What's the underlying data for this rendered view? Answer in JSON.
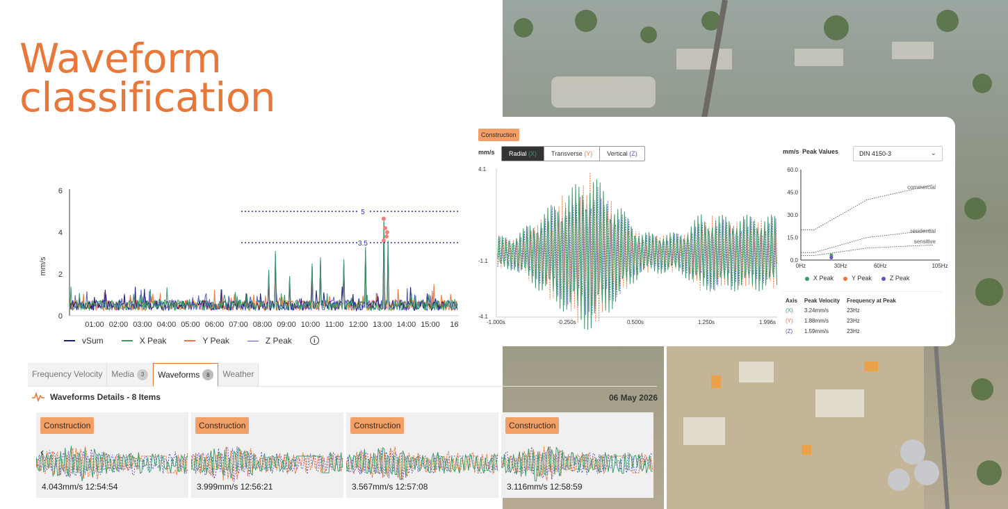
{
  "title": {
    "line1": "Waveform",
    "line2": "classification"
  },
  "main_chart": {
    "ylabel": "mm/s",
    "yticks": [
      "0",
      "2",
      "4",
      "6"
    ],
    "xticks": [
      "01:00",
      "02:00",
      "03:00",
      "04:00",
      "05:00",
      "06:00",
      "07:00",
      "08:00",
      "09:00",
      "10:00",
      "11:00",
      "12:00",
      "13:00",
      "14:00",
      "15:00",
      "16"
    ],
    "threshold_labels": [
      "5",
      "3.5"
    ],
    "legend": [
      {
        "name": "vSum",
        "color": "#1b1e7a"
      },
      {
        "name": "X Peak",
        "color": "#3a9a6a"
      },
      {
        "name": "Y Peak",
        "color": "#e8773a"
      },
      {
        "name": "Z Peak",
        "color": "#5b58c8"
      }
    ]
  },
  "chart_data": [
    {
      "type": "line",
      "ylabel": "mm/s",
      "ylim": [
        0,
        6
      ],
      "thresholds": [
        5,
        3.5
      ],
      "series": [
        {
          "name": "vSum"
        },
        {
          "name": "X Peak"
        },
        {
          "name": "Y Peak"
        },
        {
          "name": "Z Peak"
        }
      ],
      "max_value": 4.7,
      "max_time": "12:54"
    },
    {
      "type": "line",
      "xlim": [
        "-1.000s",
        "1.996s"
      ],
      "ylim": [
        -4.1,
        4.1
      ],
      "unit": "mm/s"
    },
    {
      "type": "scatter",
      "xlim": [
        0,
        105
      ],
      "ylim": [
        0,
        60
      ],
      "unit": "mm/s",
      "standard": "DIN 4150-3",
      "curves": [
        "commercial",
        "residential",
        "sensitive"
      ],
      "points": [
        {
          "name": "X Peak",
          "x": 23,
          "y": 3.24
        },
        {
          "name": "Y Peak",
          "x": 23,
          "y": 1.88
        },
        {
          "name": "Z Peak",
          "x": 23,
          "y": 1.59
        }
      ]
    }
  ],
  "tabs": [
    {
      "label": "Frequency Velocity"
    },
    {
      "label": "Media",
      "badge": "3"
    },
    {
      "label": "Waveforms",
      "badge": "8"
    },
    {
      "label": "Weather"
    }
  ],
  "details": {
    "title": "Waveforms Details - 8 Items",
    "date": "06 May 2026"
  },
  "cards": [
    {
      "tag": "Construction",
      "value": "4.043mm/s 12:54:54"
    },
    {
      "tag": "Construction",
      "value": "3.999mm/s 12:56:21"
    },
    {
      "tag": "Construction",
      "value": "3.567mm/s 12:57:08"
    },
    {
      "tag": "Construction",
      "value": "3.116mm/s 12:58:59"
    }
  ],
  "panel": {
    "tag": "Construction",
    "unit": "mm/s",
    "seg": [
      {
        "label": "Radial",
        "axis": "(X)"
      },
      {
        "label": "Transverse",
        "axis": "(Y)"
      },
      {
        "label": "Vertical",
        "axis": "(Z)"
      }
    ],
    "wave_yticks": [
      "4.1",
      "-1.1",
      "-4.1"
    ],
    "wave_xticks": [
      "-1.000s",
      "-0.250s",
      "0.500s",
      "1.250s",
      "1.996s"
    ],
    "pv_unit": "mm/s",
    "pv_title": "Peak Values",
    "select": "DIN 4150-3",
    "pv_yticks": [
      "60.0",
      "45.0",
      "30.0",
      "15.0",
      "0.0"
    ],
    "pv_xticks": [
      "0Hz",
      "30Hz",
      "60Hz",
      "105Hz"
    ],
    "curve_labels": [
      "commercial",
      "residential",
      "sensitive"
    ],
    "pv_legend": [
      {
        "name": "X Peak",
        "color": "#3a9a6a"
      },
      {
        "name": "Y Peak",
        "color": "#e8773a"
      },
      {
        "name": "Z Peak",
        "color": "#5b58c8"
      }
    ],
    "table_head": [
      "Axis",
      "Peak Velocity",
      "Frequency at Peak"
    ],
    "table": [
      {
        "axis": "(X)",
        "vel": "3.24mm/s",
        "freq": "23Hz",
        "color": "#3a9a6a"
      },
      {
        "axis": "(Y)",
        "vel": "1.88mm/s",
        "freq": "23Hz",
        "color": "#e8773a"
      },
      {
        "axis": "(Z)",
        "vel": "1.59mm/s",
        "freq": "23Hz",
        "color": "#5b58c8"
      }
    ]
  }
}
